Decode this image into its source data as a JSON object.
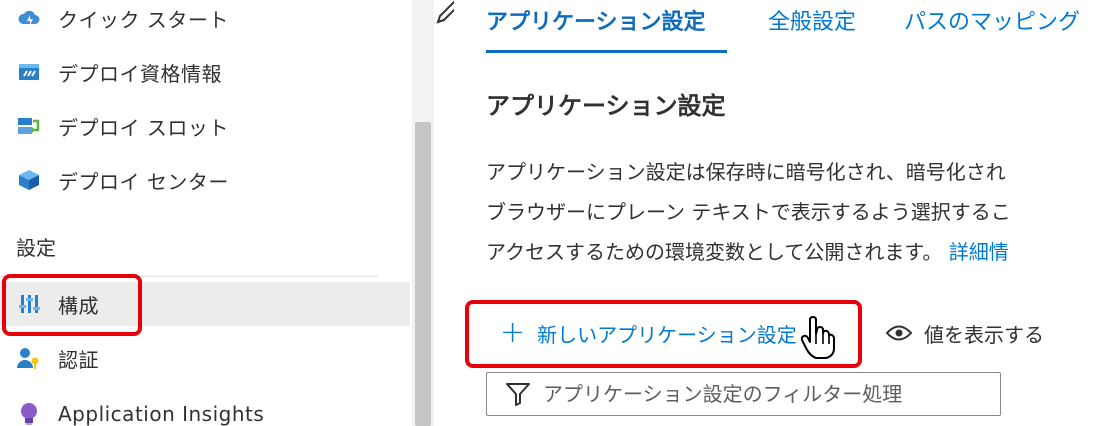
{
  "sidebar": {
    "items": [
      {
        "label": "クイック スタート",
        "icon": "cloud-quickstart-icon"
      },
      {
        "label": "デプロイ資格情報",
        "icon": "credentials-icon"
      },
      {
        "label": "デプロイ スロット",
        "icon": "slots-icon"
      },
      {
        "label": "デプロイ センター",
        "icon": "cube-icon"
      }
    ],
    "section_header": "設定",
    "settings_items": [
      {
        "label": "構成",
        "icon": "sliders-icon",
        "selected": true
      },
      {
        "label": "認証",
        "icon": "user-key-icon"
      },
      {
        "label": "Application Insights",
        "icon": "lightbulb-icon"
      }
    ]
  },
  "tabs": [
    {
      "label": "アプリケーション設定",
      "active": true
    },
    {
      "label": "全般設定",
      "active": false
    },
    {
      "label": "パスのマッピング",
      "active": false
    }
  ],
  "main": {
    "section_title": "アプリケーション設定",
    "description_lines": [
      "アプリケーション設定は保存時に暗号化され、暗号化され",
      "ブラウザーにプレーン テキストで表示するよう選択するこ",
      "アクセスするための環境変数として公開されます。"
    ],
    "description_link": "詳細情",
    "toolbar": {
      "new_setting_label": "新しいアプリケーション設定",
      "show_values_label": "値を表示する"
    },
    "filter_placeholder": "アプリケーション設定のフィルター処理"
  },
  "colors": {
    "accent": "#0078d4",
    "highlight": "#e8000b",
    "selected_bg": "#ececec"
  }
}
